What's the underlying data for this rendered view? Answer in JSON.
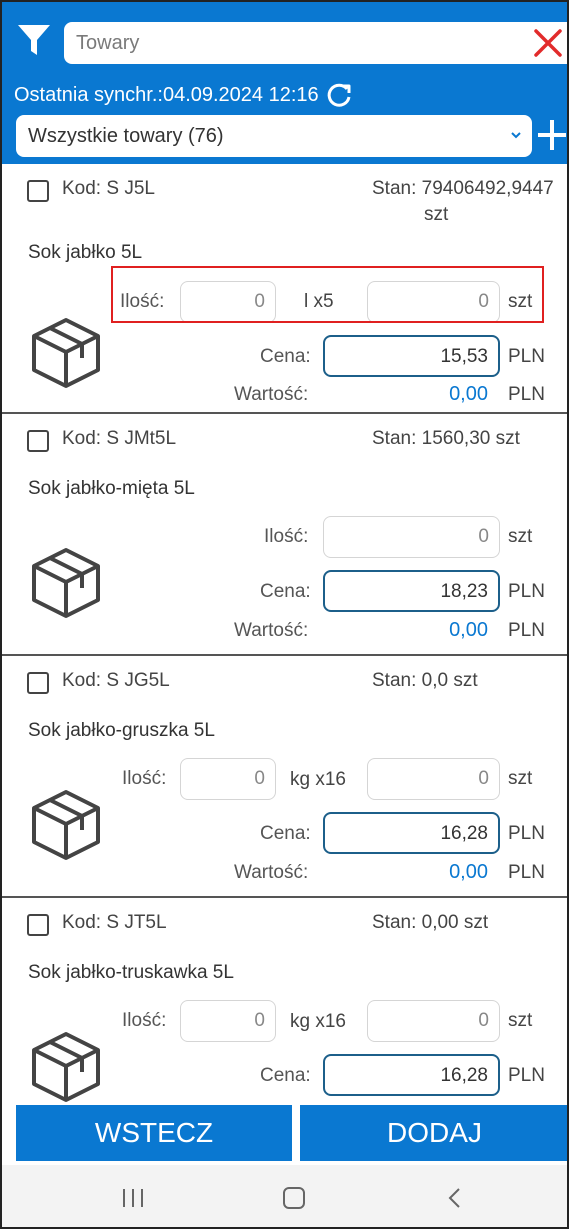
{
  "header": {
    "search_placeholder": "Towary",
    "sync_label": "Ostatnia synchr.:04.09.2024 12:16",
    "category_selected": "Wszystkie towary (76)",
    "brand_color": "#0a78d1",
    "icons": [
      "filter-icon",
      "close-icon",
      "refresh-icon",
      "chevron-down-icon",
      "plus-icon"
    ]
  },
  "products": [
    {
      "kod": "Kod: S J5L",
      "stan": "Stan: 79406492,9447",
      "stan_unit": "szt",
      "name": "Sok jabłko 5L",
      "qty_label": "Ilość:",
      "qty1_value": "0",
      "qty1_unit": "l x5",
      "qty2_value": "0",
      "qty2_unit": "szt",
      "price_label": "Cena:",
      "price_value": "15,53",
      "price_currency": "PLN",
      "value_label": "Wartość:",
      "value_amount": "0,00",
      "value_currency": "PLN"
    },
    {
      "kod": "Kod: S JMt5L",
      "stan": "Stan: 1560,30 szt",
      "name": "Sok jabłko-mięta 5L",
      "qty_label": "Ilość:",
      "qty_value": "0",
      "qty_unit": "szt",
      "price_label": "Cena:",
      "price_value": "18,23",
      "price_currency": "PLN",
      "value_label": "Wartość:",
      "value_amount": "0,00",
      "value_currency": "PLN"
    },
    {
      "kod": "Kod: S JG5L",
      "stan": "Stan: 0,0 szt",
      "name": "Sok jabłko-gruszka 5L",
      "qty_label": "Ilość:",
      "qty1_value": "0",
      "qty1_unit": "kg x16",
      "qty2_value": "0",
      "qty2_unit": "szt",
      "price_label": "Cena:",
      "price_value": "16,28",
      "price_currency": "PLN",
      "value_label": "Wartość:",
      "value_amount": "0,00",
      "value_currency": "PLN"
    },
    {
      "kod": "Kod: S JT5L",
      "stan": "Stan: 0,00 szt",
      "name": "Sok jabłko-truskawka 5L",
      "qty_label": "Ilość:",
      "qty1_value": "0",
      "qty1_unit": "kg x16",
      "qty2_value": "0",
      "qty2_unit": "szt",
      "price_label": "Cena:",
      "price_value": "16,28",
      "price_currency": "PLN"
    }
  ],
  "buttons": {
    "back_label": "WSTECZ",
    "add_label": "DODAJ"
  },
  "system_nav": {
    "icons": [
      "recent-apps-icon",
      "home-icon",
      "back-icon"
    ]
  }
}
